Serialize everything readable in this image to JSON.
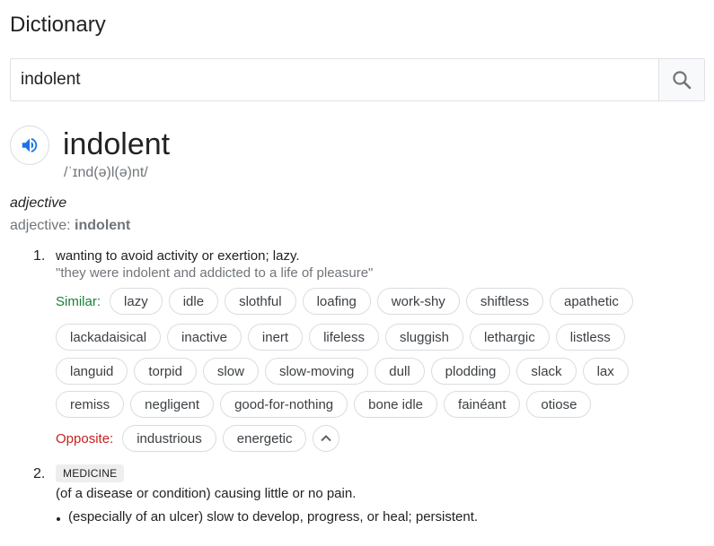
{
  "header": {
    "title": "Dictionary"
  },
  "search": {
    "value": "indolent"
  },
  "entry": {
    "word": "indolent",
    "phonetic": "/ˈɪnd(ə)l(ə)nt/",
    "part_of_speech": "adjective",
    "forms_label": "adjective: ",
    "forms_word": "indolent"
  },
  "senses": [
    {
      "number": "1.",
      "definition": "wanting to avoid activity or exertion; lazy.",
      "example": "\"they were indolent and addicted to a life of pleasure\"",
      "similar_label": "Similar:",
      "similar_rows": [
        [
          "lazy",
          "idle",
          "slothful",
          "loafing",
          "work-shy",
          "shiftless",
          "apathetic"
        ],
        [
          "lackadaisical",
          "inactive",
          "inert",
          "lifeless",
          "sluggish",
          "lethargic",
          "listless"
        ],
        [
          "languid",
          "torpid",
          "slow",
          "slow-moving",
          "dull",
          "plodding",
          "slack",
          "lax"
        ],
        [
          "remiss",
          "negligent",
          "good-for-nothing",
          "bone idle",
          "fainéant",
          "otiose"
        ]
      ],
      "opposite_label": "Opposite:",
      "opposites": [
        "industrious",
        "energetic"
      ]
    },
    {
      "number": "2.",
      "domain": "MEDICINE",
      "definition": "(of a disease or condition) causing little or no pain.",
      "subdefinition": "(especially of an ulcer) slow to develop, progress, or heal; persistent."
    }
  ],
  "icons": {
    "search": "search-icon",
    "speaker": "speaker-icon",
    "expand": "chevron-up-icon",
    "bullet": "bullet-icon"
  },
  "colors": {
    "similar_label": "#188038",
    "opposite_label": "#c5221f",
    "speaker": "#1a73e8",
    "muted_text": "#70757a",
    "chip_border": "#dadce0"
  }
}
